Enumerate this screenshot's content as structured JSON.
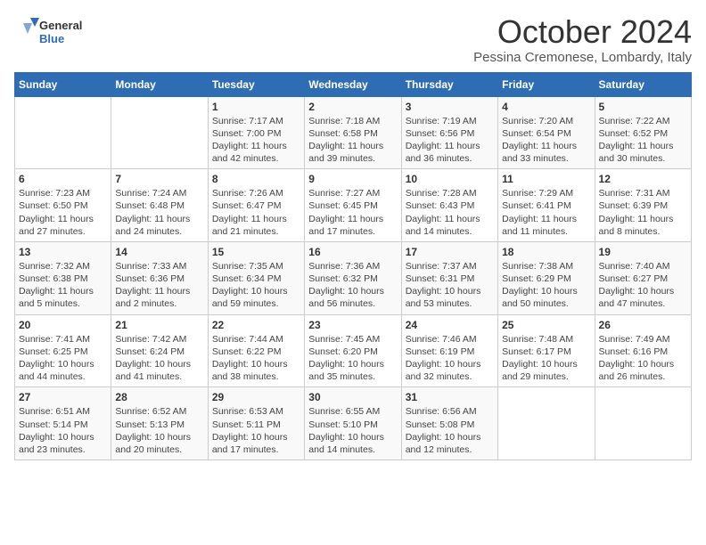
{
  "logo": {
    "general": "General",
    "blue": "Blue"
  },
  "title": "October 2024",
  "subtitle": "Pessina Cremonese, Lombardy, Italy",
  "headers": [
    "Sunday",
    "Monday",
    "Tuesday",
    "Wednesday",
    "Thursday",
    "Friday",
    "Saturday"
  ],
  "weeks": [
    [
      {
        "day": "",
        "detail": ""
      },
      {
        "day": "",
        "detail": ""
      },
      {
        "day": "1",
        "detail": "Sunrise: 7:17 AM\nSunset: 7:00 PM\nDaylight: 11 hours and 42 minutes."
      },
      {
        "day": "2",
        "detail": "Sunrise: 7:18 AM\nSunset: 6:58 PM\nDaylight: 11 hours and 39 minutes."
      },
      {
        "day": "3",
        "detail": "Sunrise: 7:19 AM\nSunset: 6:56 PM\nDaylight: 11 hours and 36 minutes."
      },
      {
        "day": "4",
        "detail": "Sunrise: 7:20 AM\nSunset: 6:54 PM\nDaylight: 11 hours and 33 minutes."
      },
      {
        "day": "5",
        "detail": "Sunrise: 7:22 AM\nSunset: 6:52 PM\nDaylight: 11 hours and 30 minutes."
      }
    ],
    [
      {
        "day": "6",
        "detail": "Sunrise: 7:23 AM\nSunset: 6:50 PM\nDaylight: 11 hours and 27 minutes."
      },
      {
        "day": "7",
        "detail": "Sunrise: 7:24 AM\nSunset: 6:48 PM\nDaylight: 11 hours and 24 minutes."
      },
      {
        "day": "8",
        "detail": "Sunrise: 7:26 AM\nSunset: 6:47 PM\nDaylight: 11 hours and 21 minutes."
      },
      {
        "day": "9",
        "detail": "Sunrise: 7:27 AM\nSunset: 6:45 PM\nDaylight: 11 hours and 17 minutes."
      },
      {
        "day": "10",
        "detail": "Sunrise: 7:28 AM\nSunset: 6:43 PM\nDaylight: 11 hours and 14 minutes."
      },
      {
        "day": "11",
        "detail": "Sunrise: 7:29 AM\nSunset: 6:41 PM\nDaylight: 11 hours and 11 minutes."
      },
      {
        "day": "12",
        "detail": "Sunrise: 7:31 AM\nSunset: 6:39 PM\nDaylight: 11 hours and 8 minutes."
      }
    ],
    [
      {
        "day": "13",
        "detail": "Sunrise: 7:32 AM\nSunset: 6:38 PM\nDaylight: 11 hours and 5 minutes."
      },
      {
        "day": "14",
        "detail": "Sunrise: 7:33 AM\nSunset: 6:36 PM\nDaylight: 11 hours and 2 minutes."
      },
      {
        "day": "15",
        "detail": "Sunrise: 7:35 AM\nSunset: 6:34 PM\nDaylight: 10 hours and 59 minutes."
      },
      {
        "day": "16",
        "detail": "Sunrise: 7:36 AM\nSunset: 6:32 PM\nDaylight: 10 hours and 56 minutes."
      },
      {
        "day": "17",
        "detail": "Sunrise: 7:37 AM\nSunset: 6:31 PM\nDaylight: 10 hours and 53 minutes."
      },
      {
        "day": "18",
        "detail": "Sunrise: 7:38 AM\nSunset: 6:29 PM\nDaylight: 10 hours and 50 minutes."
      },
      {
        "day": "19",
        "detail": "Sunrise: 7:40 AM\nSunset: 6:27 PM\nDaylight: 10 hours and 47 minutes."
      }
    ],
    [
      {
        "day": "20",
        "detail": "Sunrise: 7:41 AM\nSunset: 6:25 PM\nDaylight: 10 hours and 44 minutes."
      },
      {
        "day": "21",
        "detail": "Sunrise: 7:42 AM\nSunset: 6:24 PM\nDaylight: 10 hours and 41 minutes."
      },
      {
        "day": "22",
        "detail": "Sunrise: 7:44 AM\nSunset: 6:22 PM\nDaylight: 10 hours and 38 minutes."
      },
      {
        "day": "23",
        "detail": "Sunrise: 7:45 AM\nSunset: 6:20 PM\nDaylight: 10 hours and 35 minutes."
      },
      {
        "day": "24",
        "detail": "Sunrise: 7:46 AM\nSunset: 6:19 PM\nDaylight: 10 hours and 32 minutes."
      },
      {
        "day": "25",
        "detail": "Sunrise: 7:48 AM\nSunset: 6:17 PM\nDaylight: 10 hours and 29 minutes."
      },
      {
        "day": "26",
        "detail": "Sunrise: 7:49 AM\nSunset: 6:16 PM\nDaylight: 10 hours and 26 minutes."
      }
    ],
    [
      {
        "day": "27",
        "detail": "Sunrise: 6:51 AM\nSunset: 5:14 PM\nDaylight: 10 hours and 23 minutes."
      },
      {
        "day": "28",
        "detail": "Sunrise: 6:52 AM\nSunset: 5:13 PM\nDaylight: 10 hours and 20 minutes."
      },
      {
        "day": "29",
        "detail": "Sunrise: 6:53 AM\nSunset: 5:11 PM\nDaylight: 10 hours and 17 minutes."
      },
      {
        "day": "30",
        "detail": "Sunrise: 6:55 AM\nSunset: 5:10 PM\nDaylight: 10 hours and 14 minutes."
      },
      {
        "day": "31",
        "detail": "Sunrise: 6:56 AM\nSunset: 5:08 PM\nDaylight: 10 hours and 12 minutes."
      },
      {
        "day": "",
        "detail": ""
      },
      {
        "day": "",
        "detail": ""
      }
    ]
  ]
}
